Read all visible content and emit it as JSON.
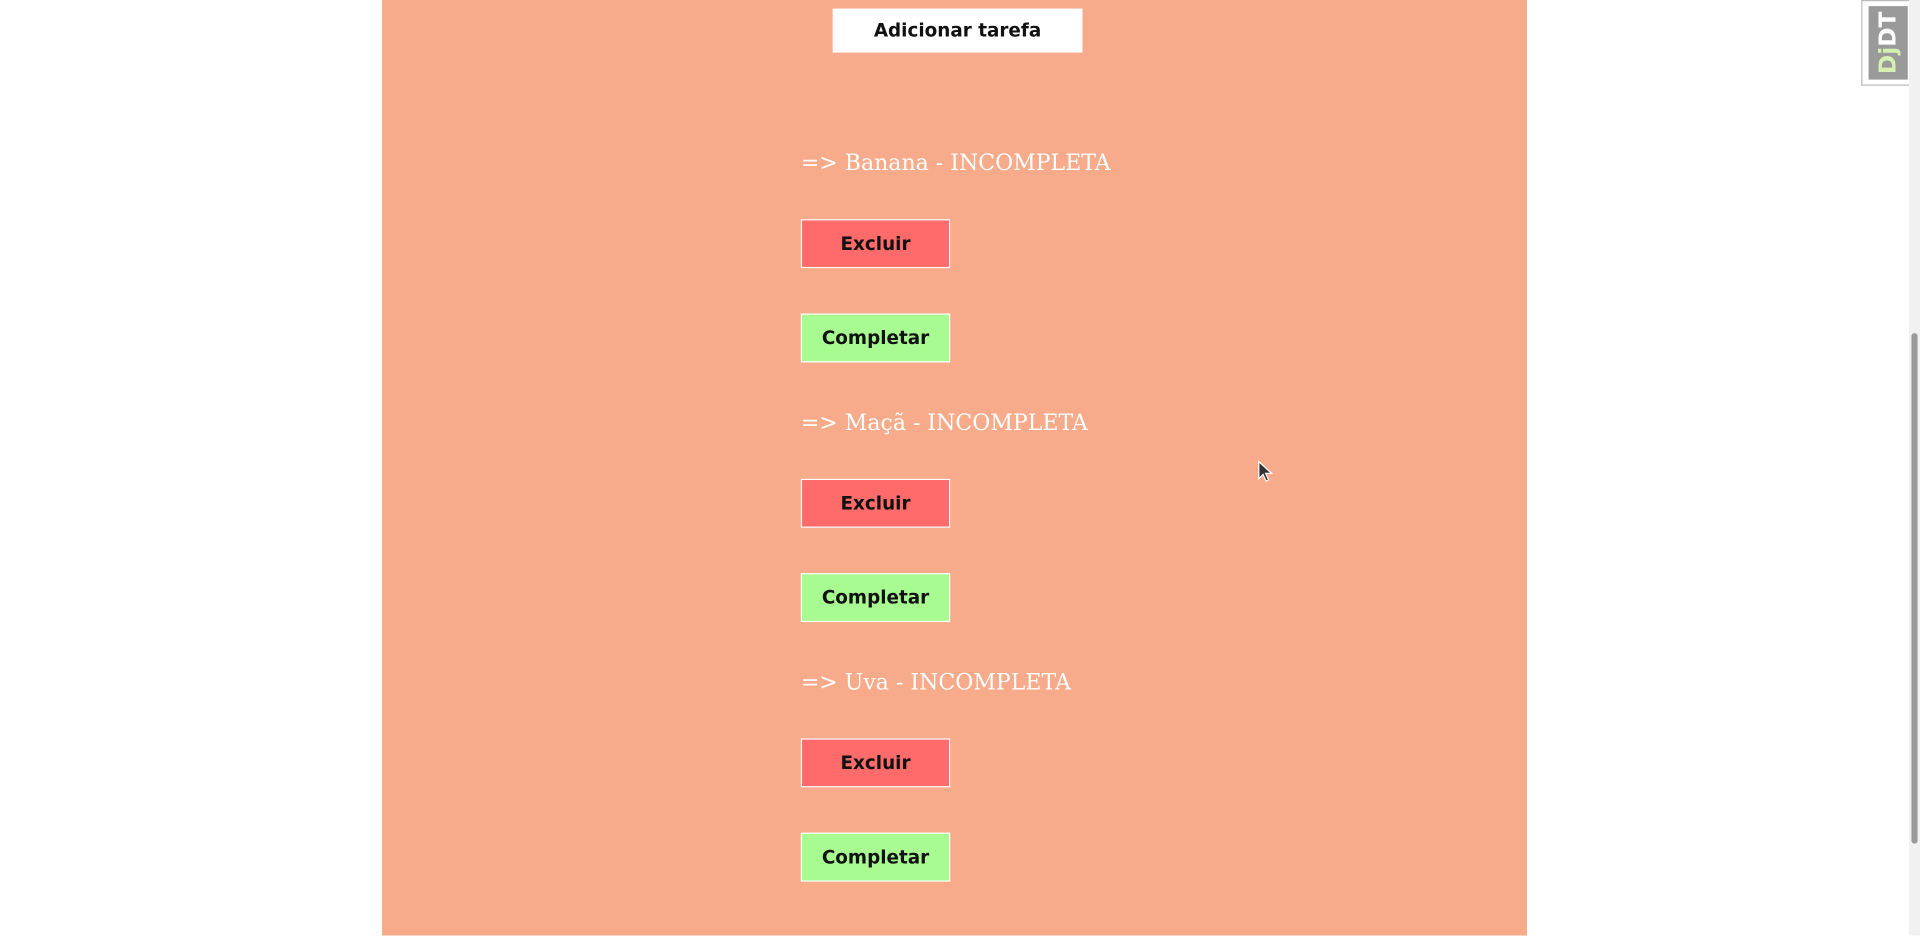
{
  "add_task": {
    "label": "Adicionar tarefa"
  },
  "tasks": [
    {
      "title": "=> Banana - INCOMPLETA",
      "delete_label": "Excluir",
      "complete_label": "Completar"
    },
    {
      "title": "=> Maçã - INCOMPLETA",
      "delete_label": "Excluir",
      "complete_label": "Completar"
    },
    {
      "title": "=> Uva - INCOMPLETA",
      "delete_label": "Excluir",
      "complete_label": "Completar"
    }
  ],
  "debug_toolbar": {
    "label_dj": "Dj",
    "label_dt": "DT"
  },
  "colors": {
    "panel_background": "#f7ab8a",
    "delete_button": "#ff6b6b",
    "complete_button": "#a8fb90",
    "task_text": "#ffffff"
  }
}
